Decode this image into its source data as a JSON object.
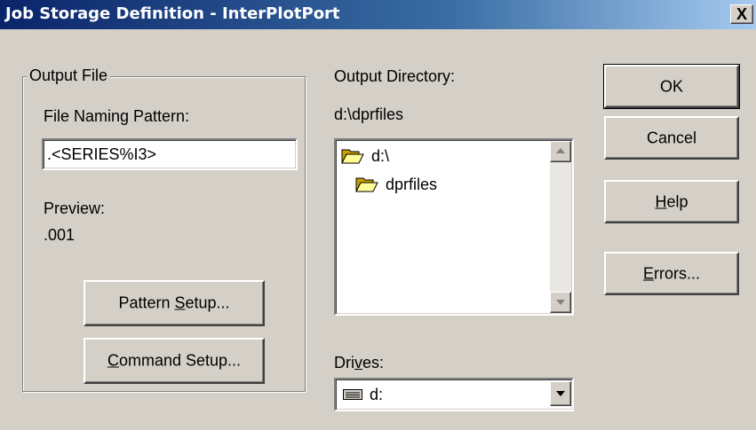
{
  "window": {
    "title": "Job Storage Definition - InterPlotPort",
    "close_label": "X"
  },
  "output_file": {
    "group_label": "Output File",
    "naming_label": "File Naming Pattern:",
    "naming_value": ".<SERIES%I3>",
    "preview_label": "Preview:",
    "preview_value": ".001",
    "pattern_setup": {
      "pre": "Pattern ",
      "hot": "S",
      "post": "etup..."
    },
    "command_setup": {
      "pre": "",
      "hot": "C",
      "post": "ommand Setup..."
    }
  },
  "output_directory": {
    "label": "Output Directory:",
    "path": "d:\\dprfiles",
    "folders": [
      {
        "name": "d:\\",
        "icon": "open-folder-icon"
      },
      {
        "name": "dprfiles",
        "icon": "open-folder-icon"
      }
    ]
  },
  "drives": {
    "label_pre": "Dri",
    "label_hot": "v",
    "label_post": "es:",
    "selected": "d:",
    "icon": "drive-icon"
  },
  "buttons": {
    "ok": "OK",
    "cancel": "Cancel",
    "help": {
      "hot": "H",
      "post": "elp"
    },
    "errors": {
      "hot": "E",
      "post": "rrors..."
    }
  },
  "colors": {
    "title_start": "#0a246a",
    "title_end": "#a6caf0",
    "face": "#d4d0c8",
    "folder": "#ffff99"
  }
}
